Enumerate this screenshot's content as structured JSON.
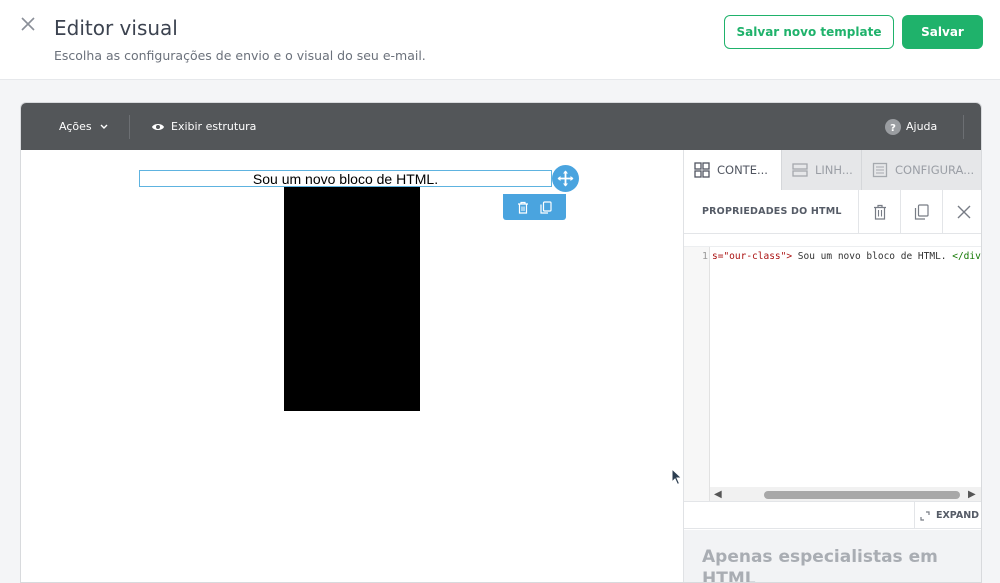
{
  "header": {
    "title": "Editor visual",
    "subtitle": "Escolha as configurações de envio e o visual do seu e-mail.",
    "save_template_label": "Salvar novo template",
    "save_label": "Salvar"
  },
  "toolbar": {
    "actions_label": "Ações",
    "structure_label": "Exibir estrutura",
    "help_label": "Ajuda"
  },
  "canvas": {
    "html_block_text": "Sou um novo bloco de HTML."
  },
  "panel": {
    "tabs": [
      {
        "label": "CONTE...",
        "icon": "grid-icon",
        "active": true
      },
      {
        "label": "LINH...",
        "icon": "rows-icon",
        "active": false
      },
      {
        "label": "CONFIGURA...",
        "icon": "settings-doc-icon",
        "active": false
      }
    ],
    "props_title": "PROPRIEDADES DO HTML",
    "code": {
      "line_number": "1",
      "attr_fragment": "s=\"our-class\">",
      "text": " Sou um novo bloco de HTML. ",
      "close_tag": "</div>"
    },
    "expand_label": "EXPAND",
    "notice_text": "Apenas especialistas em HTML"
  },
  "colors": {
    "brand_green": "#1fb26b",
    "toolbar_bg": "#535659",
    "selection_blue": "#4aa4df"
  }
}
